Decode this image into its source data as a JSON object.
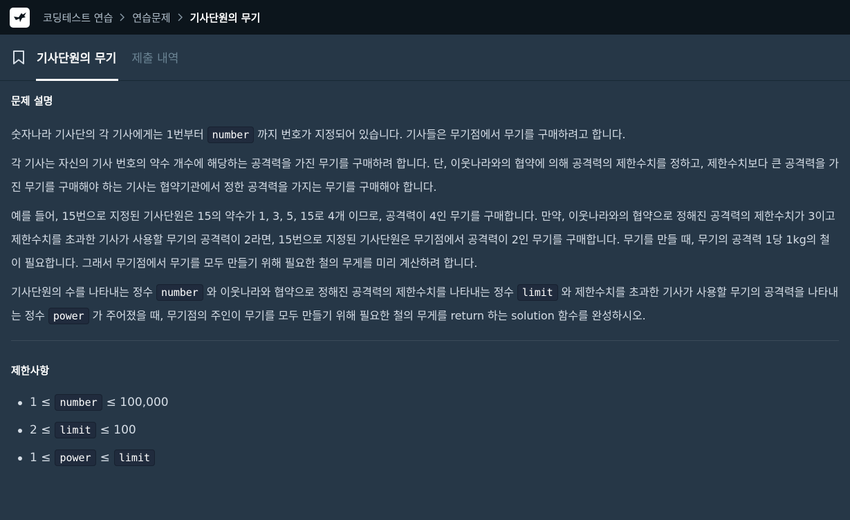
{
  "nav": {
    "breadcrumbs": [
      "코딩테스트 연습",
      "연습문제"
    ],
    "current": "기사단원의 무기"
  },
  "tabs": {
    "active": "기사단원의 무기",
    "inactive": "제출 내역"
  },
  "problem": {
    "heading": "문제 설명",
    "p1": {
      "before": "숫자나라 기사단의 각 기사에게는 1번부터",
      "code": "number",
      "after": "까지 번호가 지정되어 있습니다. 기사들은 무기점에서 무기를 구매하려고 합니다."
    },
    "p2": "각 기사는 자신의 기사 번호의 약수 개수에 해당하는 공격력을 가진 무기를 구매하려 합니다. 단, 이웃나라와의 협약에 의해 공격력의 제한수치를 정하고, 제한수치보다 큰 공격력을 가진 무기를 구매해야 하는 기사는 협약기관에서 정한 공격력을 가지는 무기를 구매해야 합니다.",
    "p3": "예를 들어, 15번으로 지정된 기사단원은 15의 약수가 1, 3, 5, 15로 4개 이므로, 공격력이 4인 무기를 구매합니다. 만약, 이웃나라와의 협약으로 정해진 공격력의 제한수치가 3이고 제한수치를 초과한 기사가 사용할 무기의 공격력이 2라면, 15번으로 지정된 기사단원은 무기점에서 공격력이 2인 무기를 구매합니다. 무기를 만들 때, 무기의 공격력 1당 1kg의 철이 필요합니다. 그래서 무기점에서 무기를 모두 만들기 위해 필요한 철의 무게를 미리 계산하려 합니다.",
    "p4": {
      "t1": "기사단원의 수를 나타내는 정수",
      "c1": "number",
      "t2": "와 이웃나라와 협약으로 정해진 공격력의 제한수치를 나타내는 정수",
      "c2": "limit",
      "t3": "와 제한수치를 초과한 기사가 사용할 무기의 공격력을 나타내는 정수",
      "c3": "power",
      "t4": "가 주어졌을 때, 무기점의 주인이 무기를 모두 만들기 위해 필요한 철의 무게를 return 하는 solution 함수를 완성하시오."
    }
  },
  "constraints": {
    "heading": "제한사항",
    "items": [
      {
        "pre": "1 ≤",
        "code": "number",
        "post": "≤ 100,000",
        "code2": ""
      },
      {
        "pre": "2 ≤",
        "code": "limit",
        "post": "≤ 100",
        "code2": ""
      },
      {
        "pre": "1 ≤",
        "code": "power",
        "post": "≤",
        "code2": "limit"
      }
    ]
  }
}
